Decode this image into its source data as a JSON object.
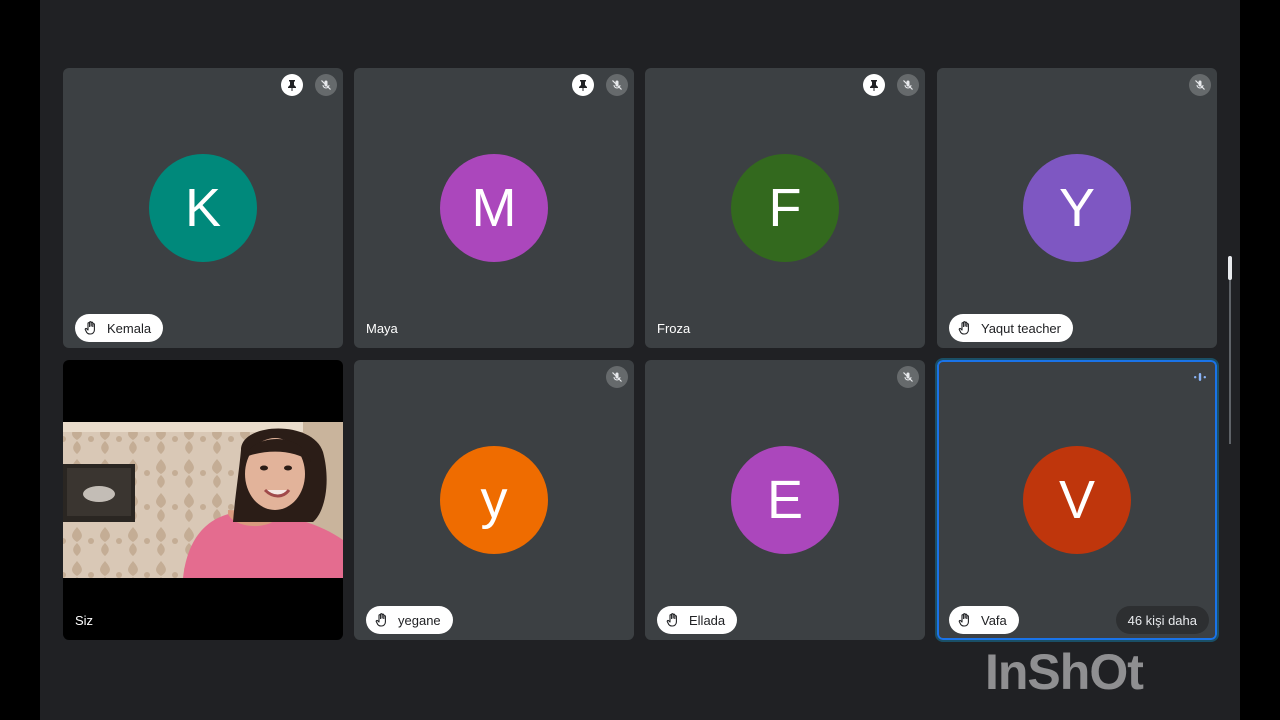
{
  "participants": [
    {
      "name": "Kemala",
      "initial": "K",
      "avatar_color": "#00897b",
      "hand_raised": true,
      "pinned": true,
      "muted": true
    },
    {
      "name": "Maya",
      "initial": "M",
      "avatar_color": "#ab47bc",
      "hand_raised": false,
      "pinned": true,
      "muted": true
    },
    {
      "name": "Froza",
      "initial": "F",
      "avatar_color": "#33691e",
      "hand_raised": false,
      "pinned": true,
      "muted": true
    },
    {
      "name": "Yaqut teacher",
      "initial": "Y",
      "avatar_color": "#7e57c2",
      "hand_raised": true,
      "pinned": false,
      "muted": true
    },
    {
      "name": "Siz",
      "has_video": true,
      "muted": false
    },
    {
      "name": "yegane",
      "initial": "y",
      "avatar_color": "#ef6c00",
      "hand_raised": true,
      "muted": true
    },
    {
      "name": "Ellada",
      "initial": "E",
      "avatar_color": "#ab47bc",
      "hand_raised": true,
      "muted": true
    },
    {
      "name": "Vafa",
      "initial": "V",
      "avatar_color": "#bf360c",
      "hand_raised": true,
      "speaking": true,
      "more_label": "46 kişi daha"
    }
  ],
  "watermark": "InShOt",
  "colors": {
    "background": "#202124",
    "tile": "#3c4043",
    "speaking_outline": "#1a73e8"
  },
  "icons": {
    "pin": "pin-icon",
    "mute": "mic-off-icon",
    "hand": "raised-hand-icon",
    "speaking": "audio-level-icon"
  }
}
